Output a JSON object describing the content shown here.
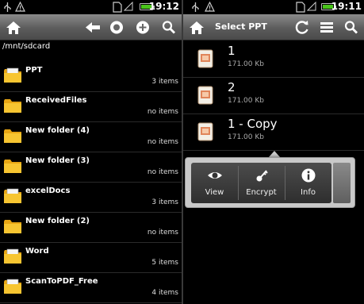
{
  "left_screen": {
    "status": {
      "time": "19:12"
    },
    "path": "/mnt/sdcard",
    "folders": [
      {
        "name": "PPT",
        "count": "3 items"
      },
      {
        "name": "ReceivedFiles",
        "count": "no items"
      },
      {
        "name": "New folder (4)",
        "count": "no items"
      },
      {
        "name": "New folder (3)",
        "count": "no items"
      },
      {
        "name": "excelDocs",
        "count": "3 items"
      },
      {
        "name": "New folder (2)",
        "count": "no items"
      },
      {
        "name": "Word",
        "count": "5 items"
      },
      {
        "name": "ScanToPDF_Free",
        "count": "4 items"
      }
    ]
  },
  "right_screen": {
    "status": {
      "time": "19:11"
    },
    "title": "Select PPT",
    "files": [
      {
        "name": "1",
        "size": "171.00 Kb"
      },
      {
        "name": "2",
        "size": "171.00 Kb"
      },
      {
        "name": "1 - Copy",
        "size": "171.00 Kb"
      }
    ],
    "quick_actions": [
      {
        "label": "View",
        "icon": "eye-icon"
      },
      {
        "label": "Encrypt",
        "icon": "key-icon"
      },
      {
        "label": "Info",
        "icon": "info-icon"
      }
    ]
  },
  "colors": {
    "battery": "#49c41a",
    "bar": "#5c5c5c",
    "folder": "#f2b81d",
    "ppt_icon": "#e0855a"
  }
}
